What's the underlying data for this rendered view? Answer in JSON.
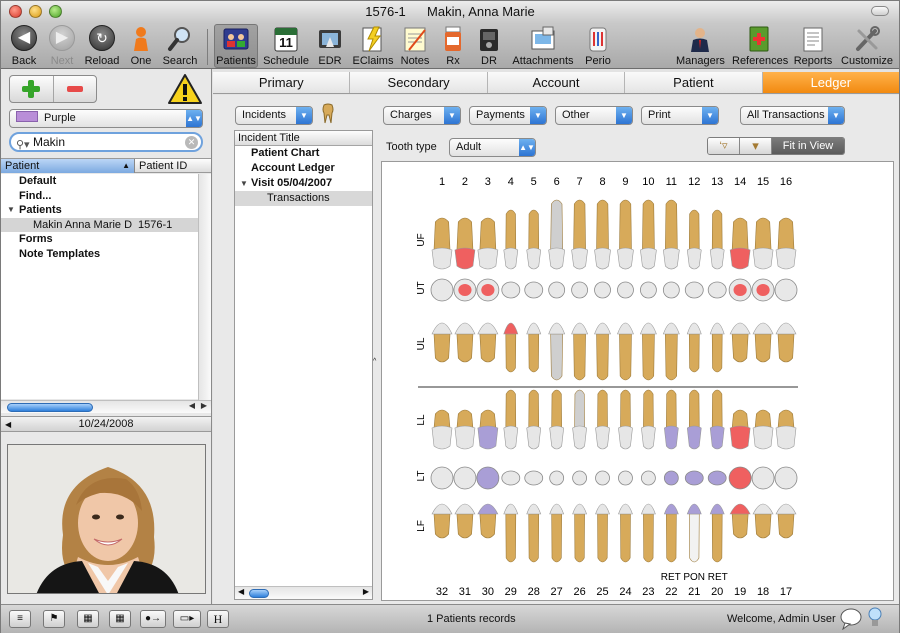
{
  "window": {
    "title_id": "1576-1",
    "title_name": "Makin, Anna Marie"
  },
  "toolbar": {
    "back": "Back",
    "next": "Next",
    "reload": "Reload",
    "one": "One",
    "search": "Search",
    "patients": "Patients",
    "schedule": "Schedule",
    "schedule_day": "11",
    "edr": "EDR",
    "eclaims": "EClaims",
    "notes": "Notes",
    "rx": "Rx",
    "dr": "DR",
    "attachments": "Attachments",
    "perio": "Perio",
    "managers": "Managers",
    "references": "References",
    "reports": "Reports",
    "customize": "Customize"
  },
  "sidebar": {
    "color_label": "Purple",
    "color_hex": "#b98ed8",
    "search_value": "Makin",
    "col_patient": "Patient",
    "col_patient_id": "Patient ID",
    "tree": [
      {
        "label": "Default",
        "bold": true,
        "indent": 18
      },
      {
        "label": "Find...",
        "bold": true,
        "indent": 18
      },
      {
        "label": "Patients",
        "bold": true,
        "indent": 18,
        "expanded": true
      },
      {
        "label": "Makin Anna Marie D",
        "id": "1576-1",
        "bold": false,
        "indent": 32,
        "selected": true
      },
      {
        "label": "Forms",
        "bold": true,
        "indent": 18
      },
      {
        "label": "Note Templates",
        "bold": true,
        "indent": 18
      }
    ],
    "date": "10/24/2008"
  },
  "tabs": [
    "Primary",
    "Secondary",
    "Account",
    "Patient",
    "Ledger"
  ],
  "active_tab": "Ledger",
  "ledger": {
    "incidents_popup": "Incidents",
    "charges": "Charges",
    "payments": "Payments",
    "other": "Other",
    "print": "Print",
    "all_transactions": "All Transactions",
    "tooth_type_label": "Tooth type",
    "tooth_type_value": "Adult",
    "fit_in_view": "Fit in View",
    "incident_header": "Incident Title",
    "incidents": [
      {
        "label": "Patient Chart",
        "bold": true,
        "indent": 16
      },
      {
        "label": "Account Ledger",
        "bold": true,
        "indent": 16
      },
      {
        "label": "Visit 05/04/2007",
        "bold": true,
        "indent": 16,
        "expanded": true
      },
      {
        "label": "Transactions",
        "bold": false,
        "indent": 32,
        "selected": true
      }
    ]
  },
  "chart": {
    "upper_numbers": [
      "1",
      "2",
      "3",
      "4",
      "5",
      "6",
      "7",
      "8",
      "9",
      "10",
      "11",
      "12",
      "13",
      "14",
      "15",
      "16"
    ],
    "lower_numbers": [
      "32",
      "31",
      "30",
      "29",
      "28",
      "27",
      "26",
      "25",
      "24",
      "23",
      "22",
      "21",
      "20",
      "19",
      "18",
      "17"
    ],
    "upper_row_labels": [
      "UF",
      "UT",
      "UL"
    ],
    "lower_row_labels": [
      "LL",
      "LT",
      "LF"
    ],
    "bridge_label": "RET PON RET",
    "tooth_color": "#d7aa5a",
    "crown_color": "#e6e6e6",
    "treatment_red": "#ef6060",
    "treatment_purple": "#a99ed6"
  },
  "status": {
    "records": "1 Patients records",
    "welcome": "Welcome, Admin User"
  }
}
